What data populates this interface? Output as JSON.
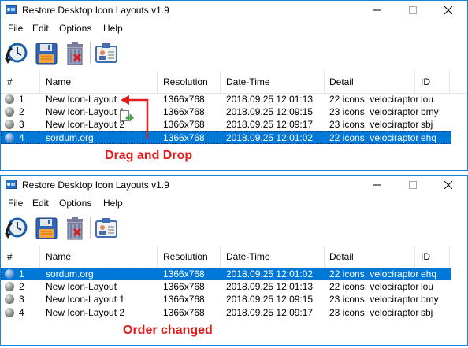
{
  "app": {
    "title": "Restore Desktop Icon Layouts v1.9",
    "menu": [
      "File",
      "Edit",
      "Options",
      "Help"
    ],
    "toolbar_icons": [
      "restore-clock-icon",
      "save-disk-icon",
      "delete-bin-icon",
      "id-card-icon"
    ]
  },
  "columns": [
    "#",
    "Name",
    "Resolution",
    "Date-Time",
    "Detail",
    "ID"
  ],
  "before": {
    "rows": [
      {
        "num": "1",
        "name": "New Icon-Layout",
        "res": "1366x768",
        "dt": "2018.09.25 12:01:13",
        "detail": "22 icons, velociraptor",
        "id": "lou",
        "selected": false
      },
      {
        "num": "2",
        "name": "New Icon-Layout 1",
        "res": "1366x768",
        "dt": "2018.09.25 12:09:15",
        "detail": "23 icons, velociraptor",
        "id": "bmy",
        "selected": false
      },
      {
        "num": "3",
        "name": "New Icon-Layout 2",
        "res": "1366x768",
        "dt": "2018.09.25 12:09:17",
        "detail": "23 icons, velociraptor",
        "id": "sbj",
        "selected": false
      },
      {
        "num": "4",
        "name": "sordum.org",
        "res": "1366x768",
        "dt": "2018.09.25 12:01:02",
        "detail": "22 icons, velociraptor",
        "id": "ehq",
        "selected": true
      }
    ],
    "annotation": "Drag and Drop"
  },
  "after": {
    "rows": [
      {
        "num": "1",
        "name": "sordum.org",
        "res": "1366x768",
        "dt": "2018.09.25 12:01:02",
        "detail": "22 icons, velociraptor",
        "id": "ehq",
        "selected": true
      },
      {
        "num": "2",
        "name": "New Icon-Layout",
        "res": "1366x768",
        "dt": "2018.09.25 12:01:13",
        "detail": "22 icons, velociraptor",
        "id": "lou",
        "selected": false
      },
      {
        "num": "3",
        "name": "New Icon-Layout 1",
        "res": "1366x768",
        "dt": "2018.09.25 12:09:15",
        "detail": "23 icons, velociraptor",
        "id": "bmy",
        "selected": false
      },
      {
        "num": "4",
        "name": "New Icon-Layout 2",
        "res": "1366x768",
        "dt": "2018.09.25 12:09:17",
        "detail": "23 icons, velociraptor",
        "id": "sbj",
        "selected": false
      }
    ],
    "annotation": "Order changed"
  },
  "colors": {
    "accent": "#1883d7",
    "selection": "#0078d7",
    "annotation": "#e31b1b"
  }
}
